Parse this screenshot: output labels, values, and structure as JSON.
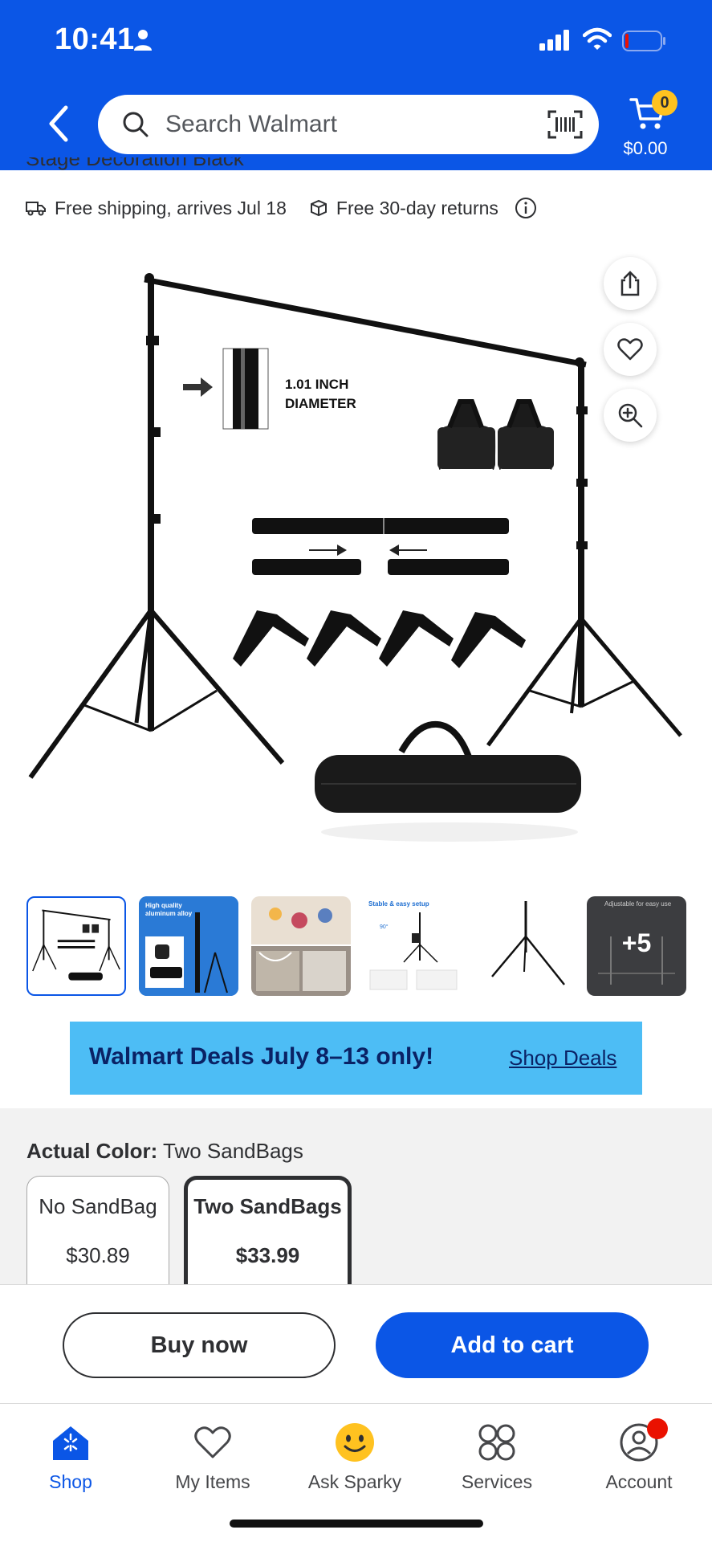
{
  "status_bar": {
    "time": "10:41",
    "icons": [
      "person-icon",
      "cellular-signal-icon",
      "wifi-icon",
      "battery-icon"
    ]
  },
  "header": {
    "search": {
      "placeholder": "Search Walmart"
    },
    "cart": {
      "count": "0",
      "total": "$0.00"
    },
    "colors": {
      "brand_blue": "#0b56e6",
      "spark_yellow": "#ffc220"
    }
  },
  "product": {
    "title_fragment": "Stage Decoration Black",
    "shipping": "Free shipping, arrives Jul 18",
    "returns": "Free 30-day returns"
  },
  "image_overlay": {
    "diameter_label_line1": "1.01 INCH",
    "diameter_label_line2": "DIAMETER"
  },
  "thumbnails": {
    "items": [
      {
        "name": "backdrop-stand-kit",
        "selected": true
      },
      {
        "name": "aluminum-alloy",
        "caption": "High quality aluminum alloy"
      },
      {
        "name": "party-scenes"
      },
      {
        "name": "stable-setup",
        "caption": "Stable & easy setup"
      },
      {
        "name": "tripod-stand"
      },
      {
        "name": "adjustable",
        "caption": "Adjustable for easy use"
      }
    ],
    "more_label": "+5"
  },
  "banner": {
    "text": "Walmart Deals July 8–13 only!",
    "link": "Shop Deals",
    "bg_color": "#4dbdf5"
  },
  "color_selector": {
    "label": "Actual Color:",
    "value": "Two SandBags",
    "options": [
      {
        "name": "No SandBag",
        "price": "$30.89",
        "selected": false
      },
      {
        "name": "Two SandBags",
        "price": "$33.99",
        "selected": true
      }
    ]
  },
  "actions": {
    "buy_now": "Buy now",
    "add_to_cart": "Add to cart"
  },
  "tabs": [
    {
      "label": "Shop",
      "icon": "shop-icon",
      "active": true
    },
    {
      "label": "My Items",
      "icon": "heart-icon",
      "active": false
    },
    {
      "label": "Ask Sparky",
      "icon": "sparky-icon",
      "active": false
    },
    {
      "label": "Services",
      "icon": "services-icon",
      "active": false
    },
    {
      "label": "Account",
      "icon": "account-icon",
      "active": false,
      "badge": true
    }
  ]
}
